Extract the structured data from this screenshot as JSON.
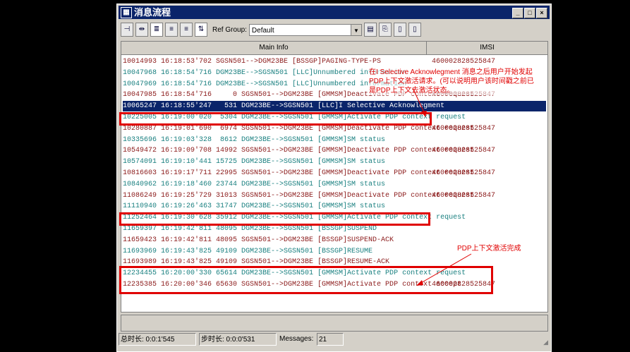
{
  "window": {
    "title": "消息流程",
    "buttons": [
      "_",
      "□",
      "×"
    ]
  },
  "toolbar": {
    "ref_group_label": "Ref Group:",
    "ref_group_value": "Default"
  },
  "columns": [
    "Main Info",
    "IMSI"
  ],
  "rows": [
    {
      "text": "10014993 16:18:53'702 SGSN501-->DGM23BE [BSSGP]PAGING-TYPE-PS",
      "imsi": "460002828525847",
      "dir": "red"
    },
    {
      "text": "10047968 16:18:54'716 DGM23BE-->SGSN501 [LLC]Unnumbered information",
      "imsi": "",
      "dir": "teal"
    },
    {
      "text": "10047969 16:18:54'716 DGM23BE-->SGSN501 [LLC]Unnumbered information",
      "imsi": "",
      "dir": "teal"
    },
    {
      "text": "10047985 16:18:54'716     0 SGSN501-->DGM23BE [GMMSM]Deactivate PDP context request",
      "imsi": "460002828525847",
      "dir": "red"
    },
    {
      "text": "10065247 16:18:55'247   531 DGM23BE-->SGSN501 [LLC]I Selective Acknowlegment",
      "imsi": "",
      "dir": "sel"
    },
    {
      "text": "10225005 16:19:00'020  5304 DGM23BE-->SGSN501 [GMMSM]Activate PDP context request",
      "imsi": "",
      "dir": "teal"
    },
    {
      "text": "10280887 16:19:01'690  6974 SGSN501-->DGM23BE [GMMSM]Deactivate PDP context request",
      "imsi": "460002828525847",
      "dir": "red"
    },
    {
      "text": "10335696 16:19:03'328  8612 DGM23BE-->SGSN501 [GMMSM]SM status",
      "imsi": "",
      "dir": "teal"
    },
    {
      "text": "10549472 16:19:09'708 14992 SGSN501-->DGM23BE [GMMSM]Deactivate PDP context request",
      "imsi": "460002828525847",
      "dir": "red"
    },
    {
      "text": "10574091 16:19:10'441 15725 DGM23BE-->SGSN501 [GMMSM]SM status",
      "imsi": "",
      "dir": "teal"
    },
    {
      "text": "10816603 16:19:17'711 22995 SGSN501-->DGM23BE [GMMSM]Deactivate PDP context request",
      "imsi": "460002828525847",
      "dir": "red"
    },
    {
      "text": "10840962 16:19:18'460 23744 DGM23BE-->SGSN501 [GMMSM]SM status",
      "imsi": "",
      "dir": "teal"
    },
    {
      "text": "11086249 16:19:25'729 31013 SGSN501-->DGM23BE [GMMSM]Deactivate PDP context request",
      "imsi": "460002828525847",
      "dir": "red"
    },
    {
      "text": "11110940 16:19:26'463 31747 DGM23BE-->SGSN501 [GMMSM]SM status",
      "imsi": "",
      "dir": "teal"
    },
    {
      "text": "11252464 16:19:30'628 35912 DGM23BE-->SGSN501 [GMMSM]Activate PDP context request",
      "imsi": "",
      "dir": "teal"
    },
    {
      "text": "11659397 16:19:42'811 48095 DGM23BE-->SGSN501 [BSSGP]SUSPEND",
      "imsi": "",
      "dir": "teal"
    },
    {
      "text": "11659423 16:19:42'811 48095 SGSN501-->DGM23BE [BSSGP]SUSPEND-ACK",
      "imsi": "",
      "dir": "red"
    },
    {
      "text": "11693969 16:19:43'825 49109 DGM23BE-->SGSN501 [BSSGP]RESUME",
      "imsi": "",
      "dir": "teal"
    },
    {
      "text": "11693989 16:19:43'825 49109 SGSN501-->DGM23BE [BSSGP]RESUME-ACK",
      "imsi": "",
      "dir": "red"
    },
    {
      "text": "12234455 16:20:00'330 65614 DGM23BE-->SGSN501 [GMMSM]Activate PDP context request",
      "imsi": "",
      "dir": "teal"
    },
    {
      "text": "12235385 16:20:00'346 65630 SGSN501-->DGM23BE [GMMSM]Activate PDP context accept",
      "imsi": "460002828525847",
      "dir": "red"
    }
  ],
  "annotations": {
    "first": "在I Selective Acknowlegment 消息之后用户开始发起PDP上下文激活请求。(可以说明用户该时间戳之前已是PDP上下文去激活状态。",
    "second": "PDP上下文激活完成"
  },
  "status": {
    "total": "总时长: 0:0:1'545",
    "step": "步时长: 0:0:0'531",
    "messages_label": "Messages:",
    "messages_value": "21"
  }
}
